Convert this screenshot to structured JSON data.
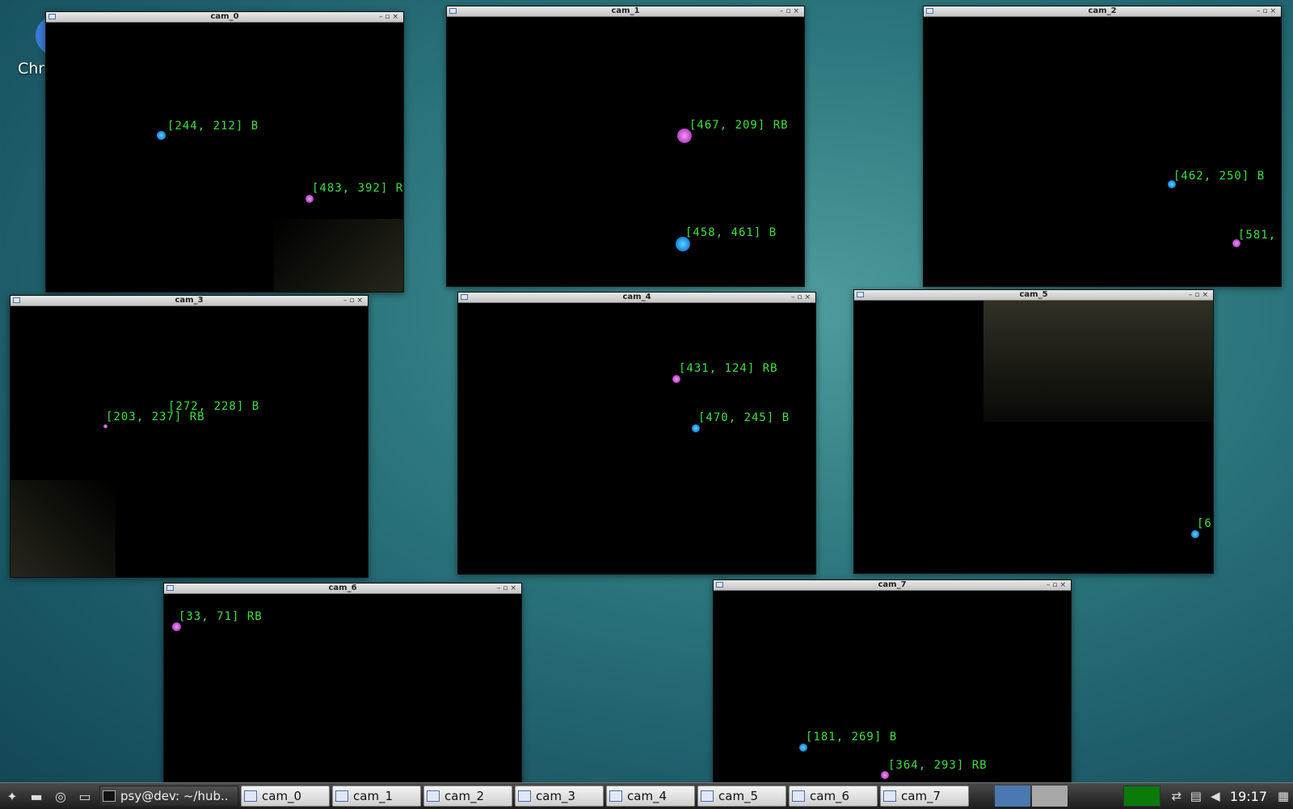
{
  "desktop": {
    "icon_label": "Chr"
  },
  "windows": [
    {
      "title": "cam_0",
      "detections": [
        {
          "label": "[244, 212] B",
          "kind": "B"
        },
        {
          "label": "[483, 392] R",
          "kind": "RB"
        }
      ]
    },
    {
      "title": "cam_1",
      "detections": [
        {
          "label": "[467, 209] RB",
          "kind": "RB"
        },
        {
          "label": "[458, 461] B",
          "kind": "B"
        }
      ]
    },
    {
      "title": "cam_2",
      "detections": [
        {
          "label": "[462, 250] B",
          "kind": "B"
        },
        {
          "label": "[581,",
          "kind": "RB"
        }
      ]
    },
    {
      "title": "cam_3",
      "detections": [
        {
          "label": "[272, 228] B",
          "kind": "B"
        },
        {
          "label": "[203, 237] RB",
          "kind": "RB"
        }
      ]
    },
    {
      "title": "cam_4",
      "detections": [
        {
          "label": "[431, 124] RB",
          "kind": "RB"
        },
        {
          "label": "[470, 245] B",
          "kind": "B"
        }
      ]
    },
    {
      "title": "cam_5",
      "detections": [
        {
          "label": "[6",
          "kind": "B"
        }
      ]
    },
    {
      "title": "cam_6",
      "detections": [
        {
          "label": "[33, 71] RB",
          "kind": "RB"
        }
      ]
    },
    {
      "title": "cam_7",
      "detections": [
        {
          "label": "[181, 269] B",
          "kind": "B"
        },
        {
          "label": "[364, 293] RB",
          "kind": "RB"
        }
      ]
    }
  ],
  "window_controls": "–▫×",
  "taskbar": {
    "terminal_label": "psy@dev: ~/hub..",
    "tasks": [
      "cam_0",
      "cam_1",
      "cam_2",
      "cam_3",
      "cam_4",
      "cam_5",
      "cam_6",
      "cam_7"
    ],
    "clock": "19:17"
  },
  "colors": {
    "blob_B": "#1d8fe0",
    "blob_RB": "#c04ad0",
    "label_green": "#3fe03f",
    "cpu_meter": "#0a7a0a"
  }
}
